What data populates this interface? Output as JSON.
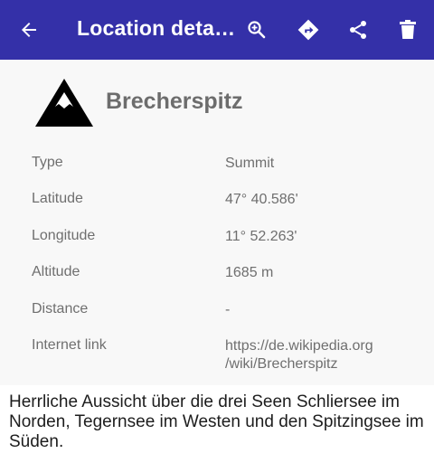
{
  "appbar": {
    "title": "Location deta…",
    "icons": [
      "arrow-back-icon",
      "zoom-in-icon",
      "directions-icon",
      "share-icon",
      "delete-icon"
    ],
    "color": "#3430a8"
  },
  "location": {
    "icon": "mountain-icon",
    "name": "Brecherspitz"
  },
  "details": [
    {
      "label": "Type",
      "value": "Summit"
    },
    {
      "label": "Latitude",
      "value": "47° 40.586'"
    },
    {
      "label": "Longitude",
      "value": "11° 52.263'"
    },
    {
      "label": "Altitude",
      "value": "1685 m"
    },
    {
      "label": "Distance",
      "value": "-"
    },
    {
      "label": "Internet link",
      "value_line1": "https://de.wikipedia.org",
      "value_line2": "/wiki/Brecherspitz"
    }
  ],
  "description": "Herrliche Aussicht über die drei Seen Schliersee im Norden, Tegernsee im Westen und den Spitzingsee im Süden."
}
